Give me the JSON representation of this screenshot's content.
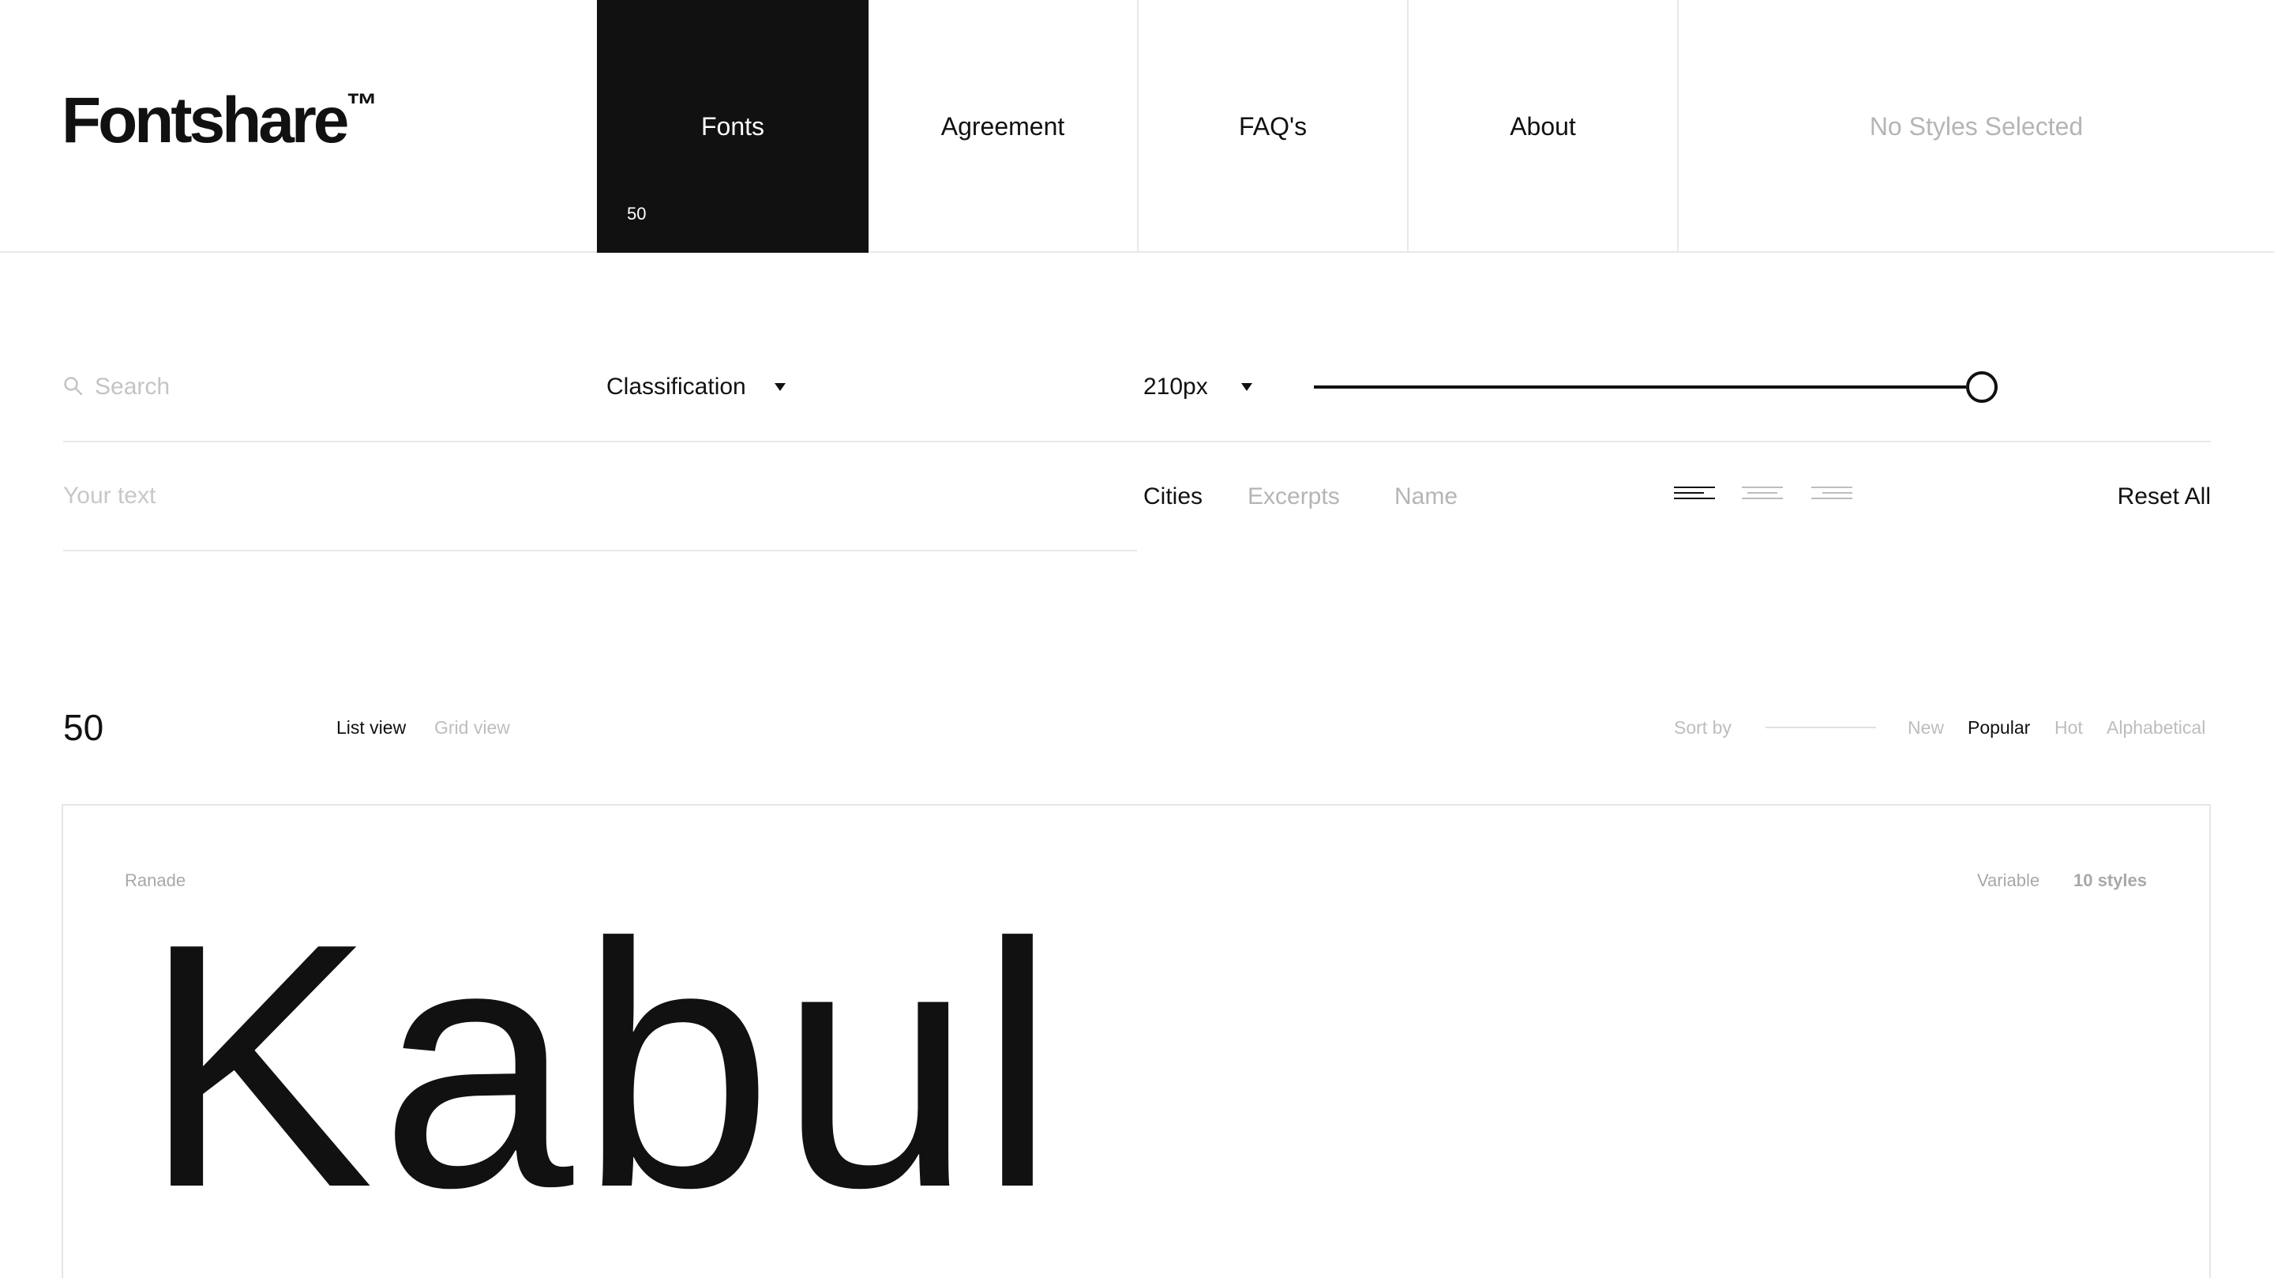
{
  "logo": {
    "text": "Fontshare",
    "mark": "™"
  },
  "nav": {
    "fonts": {
      "label": "Fonts",
      "count": "50"
    },
    "agreement": {
      "label": "Agreement"
    },
    "faq": {
      "label": "FAQ's"
    },
    "about": {
      "label": "About"
    },
    "styles_status": "No Styles Selected"
  },
  "filters": {
    "search_placeholder": "Search",
    "classification_label": "Classification",
    "size_value": "210px",
    "size_slider_fraction": 1.0
  },
  "text_row": {
    "placeholder": "Your text",
    "presets": [
      {
        "label": "Cities",
        "active": true
      },
      {
        "label": "Excerpts",
        "active": false
      },
      {
        "label": "Name",
        "active": false
      }
    ],
    "alignment": [
      "align-left",
      "align-center",
      "align-right"
    ],
    "alignment_selected": "align-left",
    "reset_label": "Reset All"
  },
  "list_bar": {
    "count": "50",
    "views": [
      {
        "label": "List view",
        "active": true
      },
      {
        "label": "Grid view",
        "active": false
      }
    ],
    "sort_label": "Sort by",
    "sort_options": [
      {
        "label": "New",
        "active": false
      },
      {
        "label": "Popular",
        "active": true
      },
      {
        "label": "Hot",
        "active": false
      },
      {
        "label": "Alphabetical",
        "active": false
      }
    ]
  },
  "font_card": {
    "name": "Ranade",
    "type": "Variable",
    "styles": "10 styles",
    "preview_text": "Kabul"
  },
  "colors": {
    "ink": "#111111",
    "muted": "#b5b5b5",
    "border": "#e8e8e8",
    "background": "#ffffff"
  }
}
